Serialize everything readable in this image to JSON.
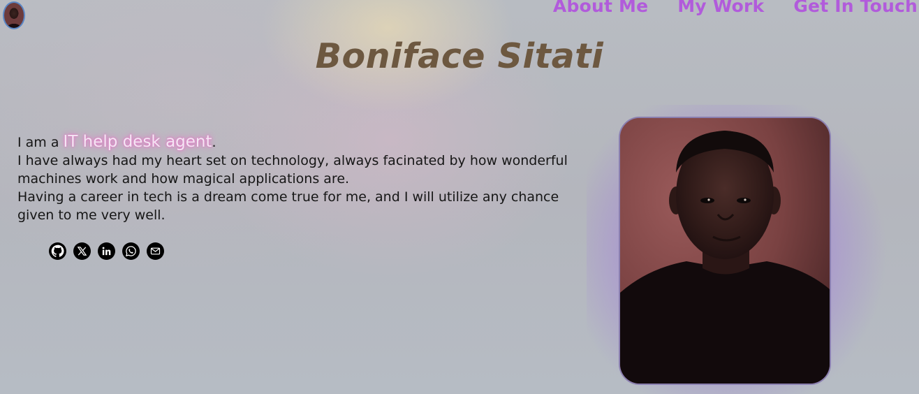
{
  "header": {
    "avatar_alt": "profile avatar",
    "nav": [
      {
        "label": "About Me"
      },
      {
        "label": "My Work"
      },
      {
        "label": "Get In Touch"
      }
    ]
  },
  "hero": {
    "title": "Boniface Sitati"
  },
  "intro": {
    "prefix": "I am a ",
    "role": "IT help desk agent",
    "suffix": ".",
    "line1": "I have always had my heart set on technology, always facinated by how wonderful machines work and how magical applications are.",
    "line2": "Having a career in tech is a dream come true for me, and I will utilize any chance given to me very well."
  },
  "socials": [
    {
      "icon": "github-icon"
    },
    {
      "icon": "x-twitter-icon"
    },
    {
      "icon": "linkedin-icon"
    },
    {
      "icon": "whatsapp-icon"
    },
    {
      "icon": "email-icon"
    }
  ],
  "colors": {
    "nav_link": "#b15bdb",
    "title": "#6d5840",
    "role_glow": "#e07cc6",
    "portrait_glow": "#9e76de"
  }
}
